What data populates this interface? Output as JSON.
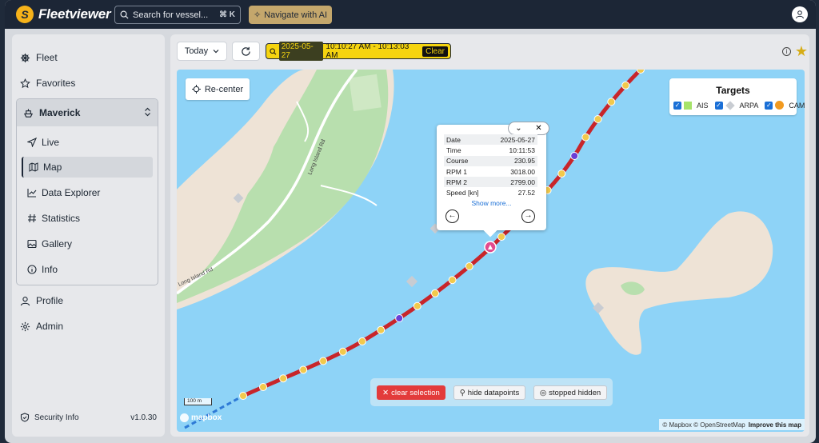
{
  "app": {
    "name": "Fleetviewer",
    "logo_letter": "S"
  },
  "header": {
    "search_placeholder": "Search for vessel...",
    "search_shortcut": "⌘ K",
    "navigate_ai_label": "Navigate with AI"
  },
  "sidebar": {
    "top_items": [
      {
        "label": "Fleet",
        "icon": "ship-wheel-icon"
      },
      {
        "label": "Favorites",
        "icon": "star-icon"
      }
    ],
    "vessel": {
      "name": "Maverick",
      "items": [
        {
          "label": "Live",
          "icon": "navigation-icon"
        },
        {
          "label": "Map",
          "icon": "map-icon",
          "active": true
        },
        {
          "label": "Data Explorer",
          "icon": "chart-icon"
        },
        {
          "label": "Statistics",
          "icon": "hash-icon"
        },
        {
          "label": "Gallery",
          "icon": "image-icon"
        },
        {
          "label": "Info",
          "icon": "info-icon"
        }
      ]
    },
    "bottom_items": [
      {
        "label": "Profile",
        "icon": "user-icon"
      },
      {
        "label": "Admin",
        "icon": "gear-icon"
      }
    ],
    "footer": {
      "security_label": "Security Info",
      "version": "v1.0.30"
    }
  },
  "toolbar": {
    "period_label": "Today",
    "range_date": "2025-05-27",
    "range_times": "10:10:27 AM - 10:13:03 AM",
    "clear_label": "Clear"
  },
  "map": {
    "recenter_label": "Re-center",
    "road_label": "Long Island Rd",
    "road_label_2": "Long Island Rd",
    "targets": {
      "title": "Targets",
      "items": [
        {
          "label": "AIS",
          "checked": true,
          "color": "#a6e36a"
        },
        {
          "label": "ARPA",
          "checked": true,
          "color": "#c8ccd2"
        },
        {
          "label": "CAM",
          "checked": true,
          "color": "#f29a1f"
        }
      ]
    },
    "popup": {
      "rows": [
        {
          "k": "Date",
          "v": "2025-05-27"
        },
        {
          "k": "Time",
          "v": "10:11:53"
        },
        {
          "k": "Course",
          "v": "230.95"
        },
        {
          "k": "RPM 1",
          "v": "3018.00"
        },
        {
          "k": "RPM 2",
          "v": "2799.00"
        },
        {
          "k": "Speed [kn]",
          "v": "27.52"
        }
      ],
      "show_more": "Show more..."
    },
    "actions": {
      "clear_selection": "clear selection",
      "hide_datapoints": "hide datapoints",
      "stopped_hidden": "stopped hidden"
    },
    "scale_label": "100 m",
    "mapbox_label": "mapbox",
    "attribution": "© Mapbox © OpenStreetMap",
    "improve_label": "Improve this map",
    "colors": {
      "water": "#8ed3f7",
      "land": "#eee3d6",
      "park": "#b8dfae",
      "track": "#c8252a",
      "point": "#f2c94c"
    }
  }
}
